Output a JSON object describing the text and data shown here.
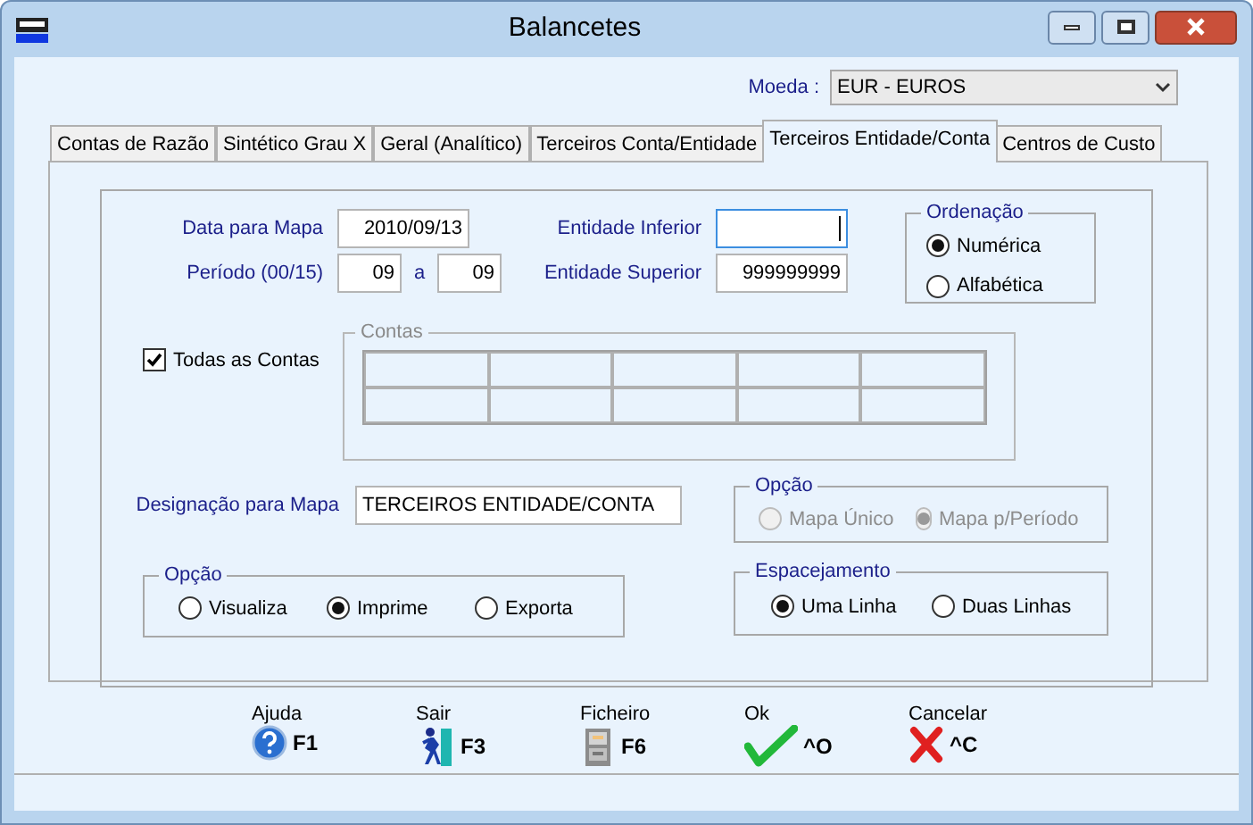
{
  "window": {
    "title": "Balancetes"
  },
  "currency": {
    "label": "Moeda :",
    "value": "EUR - EUROS"
  },
  "tabs": [
    {
      "label": "Contas de Razão",
      "selected": false
    },
    {
      "label": "Sintético Grau X",
      "selected": false
    },
    {
      "label": "Geral (Analítico)",
      "selected": false
    },
    {
      "label": "Terceiros Conta/Entidade",
      "selected": false
    },
    {
      "label": "Terceiros Entidade/Conta",
      "selected": true
    },
    {
      "label": "Centros de Custo",
      "selected": false
    }
  ],
  "form": {
    "date": {
      "label": "Data para Mapa",
      "value": "2010/09/13"
    },
    "period": {
      "label": "Período (00/15)",
      "from": "09",
      "separator": "a",
      "to": "09"
    },
    "entity_lower": {
      "label": "Entidade Inferior",
      "focused": true
    },
    "entity_upper": {
      "label": "Entidade Superior",
      "value": "999999999",
      "focused": false
    },
    "ordering": {
      "title": "Ordenação",
      "options": [
        {
          "label": "Numérica",
          "selected": true
        },
        {
          "label": "Alfabética",
          "selected": false
        }
      ]
    },
    "all_accounts": {
      "label": "Todas as Contas",
      "checked": true
    },
    "accounts": {
      "title": "Contas"
    },
    "designation": {
      "label": "Designação para Mapa",
      "value": "TERCEIROS ENTIDADE/CONTA"
    },
    "map_option": {
      "title": "Opção",
      "disabled": true,
      "options": [
        {
          "label": "Mapa Único",
          "selected": false
        },
        {
          "label": "Mapa p/Período",
          "selected": true
        }
      ]
    },
    "output_option": {
      "title": "Opção",
      "disabled": false,
      "options": [
        {
          "label": "Visualiza",
          "selected": false
        },
        {
          "label": "Imprime",
          "selected": true
        },
        {
          "label": "Exporta",
          "selected": false
        }
      ]
    },
    "spacing": {
      "title": "Espacejamento",
      "disabled": false,
      "options": [
        {
          "label": "Uma Linha",
          "selected": true
        },
        {
          "label": "Duas Linhas",
          "selected": false
        }
      ]
    }
  },
  "toolbar": [
    {
      "kind": "help",
      "label": "Ajuda",
      "key": "F1"
    },
    {
      "kind": "exit",
      "label": "Sair",
      "key": "F3"
    },
    {
      "kind": "file",
      "label": "Ficheiro",
      "key": "F6"
    },
    {
      "kind": "ok",
      "label": "Ok",
      "key": "^O"
    },
    {
      "kind": "cancel",
      "label": "Cancelar",
      "key": "^C"
    }
  ]
}
